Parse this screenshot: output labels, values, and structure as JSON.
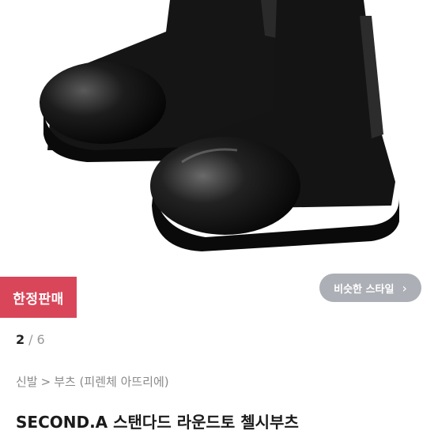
{
  "product": {
    "badge": "한정판매",
    "similar_button": "비슷한 스타일",
    "counter": {
      "current": "2",
      "separator": "/",
      "total": "6"
    },
    "breadcrumb": {
      "category": "신발",
      "separator": ">",
      "subcategory": "부츠 (피렌체 아뜨리에)"
    },
    "title": "SECOND.A 스탠다드 라운드토 첼시부츠"
  }
}
